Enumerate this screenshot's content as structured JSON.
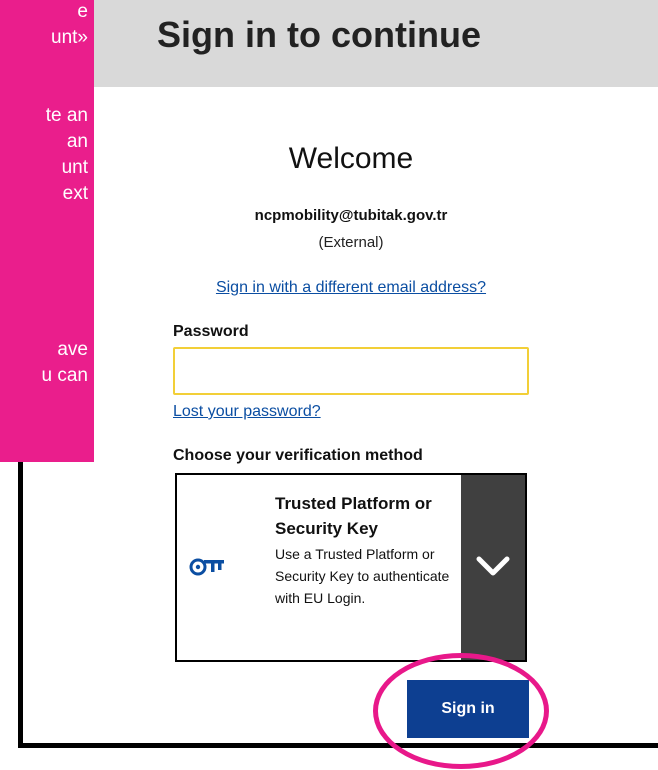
{
  "callout": {
    "lines": [
      "e",
      "unt»",
      "te an",
      "an",
      "unt",
      "ext",
      "ave",
      "u can"
    ]
  },
  "dialog": {
    "title": "Sign in to continue"
  },
  "login": {
    "welcome": "Welcome",
    "email": "ncpmobility@tubitak.gov.tr",
    "account_type": "(External)",
    "different_email_link": "Sign in with a different email address?",
    "password_label": "Password",
    "password_value": "",
    "lost_password_link": "Lost your password?",
    "verification_label": "Choose your verification method",
    "method": {
      "icon": "key-icon",
      "title": "Trusted Platform or Security Key",
      "description": "Use a Trusted Platform or Security Key to authenticate with EU Login.",
      "toggle_icon": "chevron-down-icon"
    },
    "sign_in_button": "Sign in"
  },
  "colors": {
    "accent": "#0d3f91",
    "link": "#0b4ea2",
    "callout": "#ea1e8c",
    "input_border": "#f2cf38",
    "toggle_bg": "#404040"
  }
}
